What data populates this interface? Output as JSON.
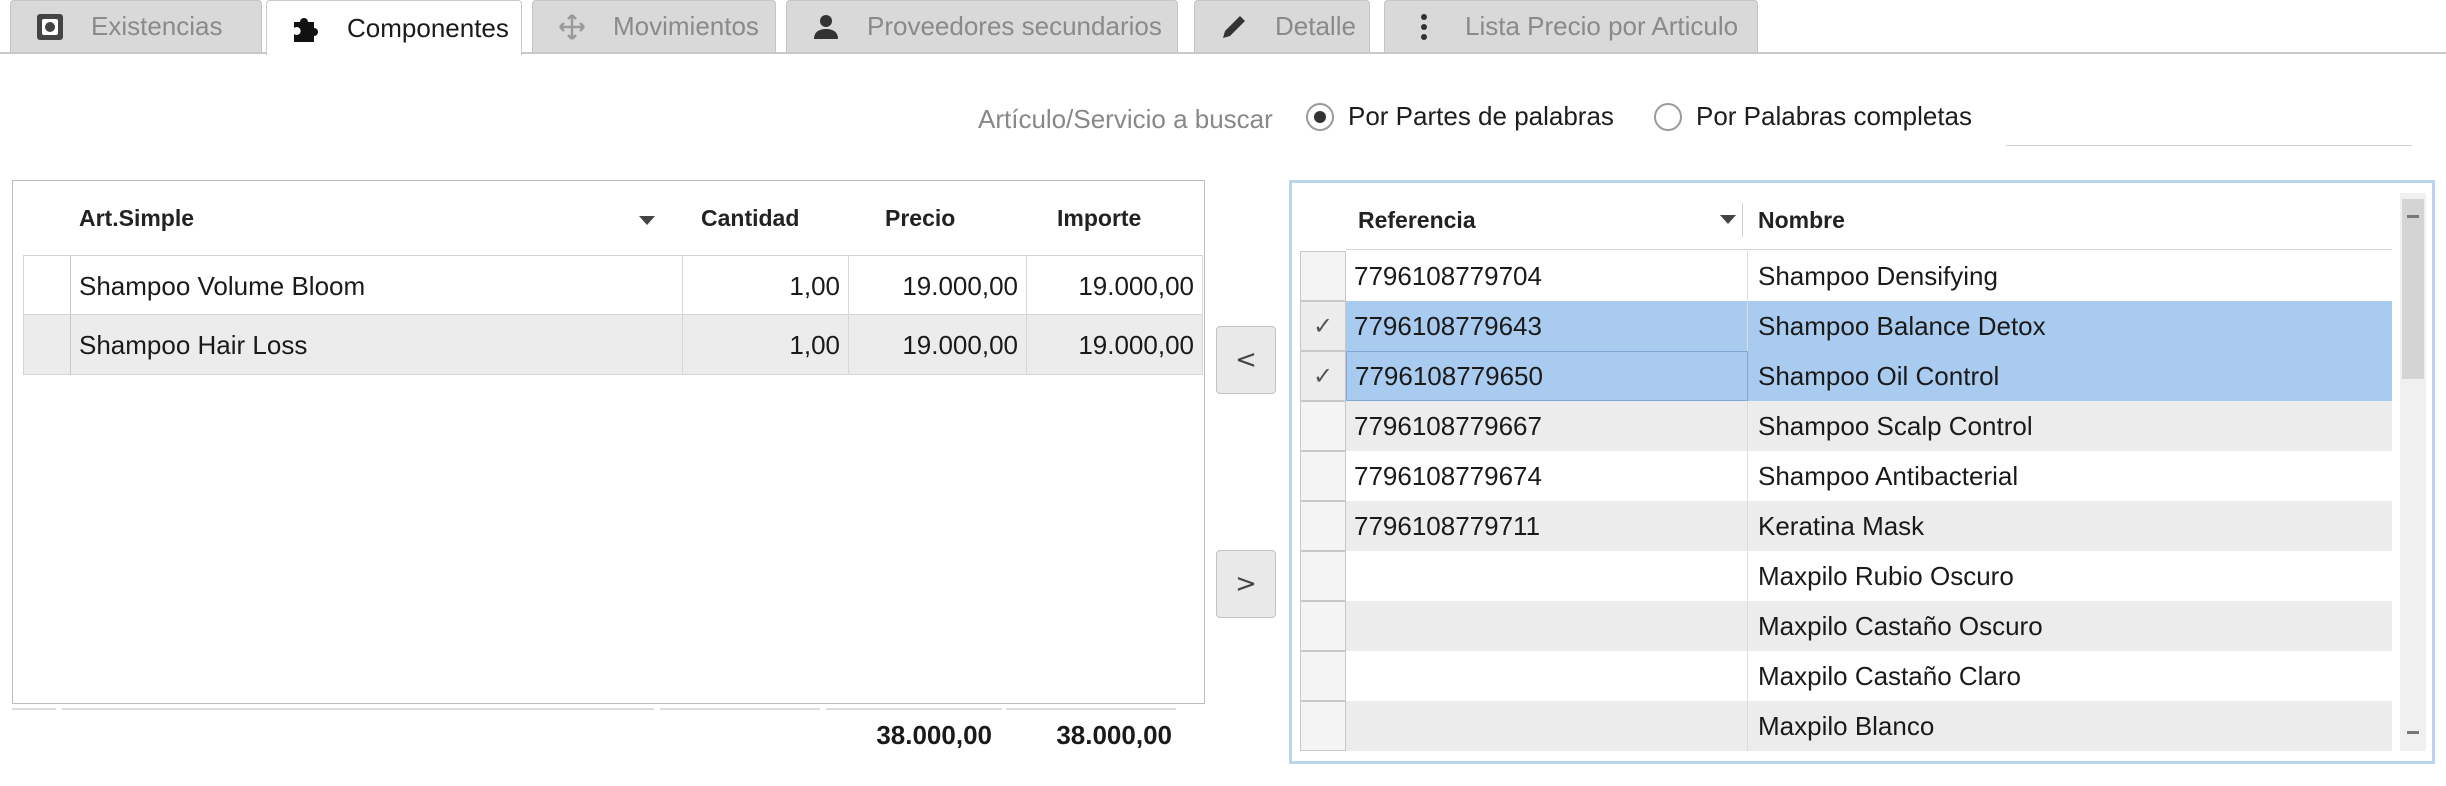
{
  "tabs": [
    {
      "label": "Existencias",
      "icon": "stock-icon",
      "active": false
    },
    {
      "label": "Componentes",
      "icon": "puzzle-icon",
      "active": true
    },
    {
      "label": "Movimientos",
      "icon": "move-icon",
      "active": false
    },
    {
      "label": "Proveedores secundarios",
      "icon": "person-icon",
      "active": false
    },
    {
      "label": "Detalle",
      "icon": "pencil-icon",
      "active": false
    },
    {
      "label": "Lista Precio por Articulo",
      "icon": "kebab-icon",
      "active": false
    }
  ],
  "search": {
    "label": "Artículo/Servicio a buscar",
    "option_partial": "Por Partes de palabras",
    "option_whole": "Por Palabras completas",
    "selected": "partial",
    "value": "",
    "placeholder": ""
  },
  "components_table": {
    "columns": [
      "Art.Simple",
      "Cantidad",
      "Precio",
      "Importe"
    ],
    "rows": [
      {
        "art": "Shampoo Volume Bloom",
        "cantidad": "1,00",
        "precio": "19.000,00",
        "importe": "19.000,00"
      },
      {
        "art": "Shampoo Hair Loss",
        "cantidad": "1,00",
        "precio": "19.000,00",
        "importe": "19.000,00"
      }
    ],
    "total_precio": "38.000,00",
    "total_importe": "38.000,00"
  },
  "move_buttons": {
    "left": "<",
    "right": ">"
  },
  "articles_table": {
    "columns": [
      "Referencia",
      "Nombre"
    ],
    "check_mark": "✓",
    "rows": [
      {
        "ref": "7796108779704",
        "name": "Shampoo Densifying",
        "checked": false
      },
      {
        "ref": "7796108779643",
        "name": "Shampoo Balance Detox",
        "checked": true
      },
      {
        "ref": "7796108779650",
        "name": "Shampoo Oil Control",
        "checked": true
      },
      {
        "ref": "7796108779667",
        "name": "Shampoo Scalp Control",
        "checked": false
      },
      {
        "ref": "7796108779674",
        "name": "Shampoo Antibacterial",
        "checked": false
      },
      {
        "ref": "7796108779711",
        "name": "Keratina Mask",
        "checked": false
      },
      {
        "ref": "",
        "name": "Maxpilo Rubio Oscuro",
        "checked": false
      },
      {
        "ref": "",
        "name": "Maxpilo Castaño Oscuro",
        "checked": false
      },
      {
        "ref": "",
        "name": "Maxpilo Castaño Claro",
        "checked": false
      },
      {
        "ref": "",
        "name": "Maxpilo Blanco",
        "checked": false
      }
    ]
  },
  "colors": {
    "selection": "#a9cbf0",
    "focus_border": "#bcd5ee",
    "tab_inactive": "#d9d9d9"
  }
}
